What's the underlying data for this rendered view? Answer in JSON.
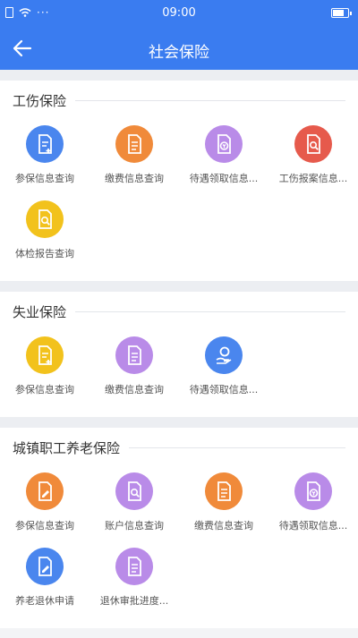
{
  "status": {
    "time": "09:00",
    "signal_dots": "···"
  },
  "header": {
    "title": "社会保险"
  },
  "colors": {
    "primary": "#3a7cf0",
    "blue": "#4a86ee",
    "orange": "#f08a3a",
    "purple": "#b98be8",
    "red": "#e65a4c",
    "yellow": "#f2c21c"
  },
  "sections": [
    {
      "title": "工伤保险",
      "items": [
        {
          "label": "参保信息查询",
          "color": "#4a86ee",
          "icon": "doc-plus-icon"
        },
        {
          "label": "缴费信息查询",
          "color": "#f08a3a",
          "icon": "doc-list-icon"
        },
        {
          "label": "待遇领取信息...",
          "color": "#b98be8",
          "icon": "doc-yuan-icon"
        },
        {
          "label": "工伤报案信息...",
          "color": "#e65a4c",
          "icon": "doc-search-icon"
        },
        {
          "label": "体检报告查询",
          "color": "#f2c21c",
          "icon": "doc-search-icon"
        }
      ]
    },
    {
      "title": "失业保险",
      "items": [
        {
          "label": "参保信息查询",
          "color": "#f2c21c",
          "icon": "doc-plus-icon"
        },
        {
          "label": "缴费信息查询",
          "color": "#b98be8",
          "icon": "doc-list-icon"
        },
        {
          "label": "待遇领取信息...",
          "color": "#4a86ee",
          "icon": "hand-coin-icon"
        }
      ]
    },
    {
      "title": "城镇职工养老保险",
      "items": [
        {
          "label": "参保信息查询",
          "color": "#f08a3a",
          "icon": "doc-edit-icon"
        },
        {
          "label": "账户信息查询",
          "color": "#b98be8",
          "icon": "doc-search-icon"
        },
        {
          "label": "缴费信息查询",
          "color": "#f08a3a",
          "icon": "doc-list-icon"
        },
        {
          "label": "待遇领取信息...",
          "color": "#b98be8",
          "icon": "doc-yuan-icon"
        },
        {
          "label": "养老退休申请",
          "color": "#4a86ee",
          "icon": "doc-edit-icon"
        },
        {
          "label": "退休审批进度...",
          "color": "#b98be8",
          "icon": "doc-list-icon"
        }
      ]
    }
  ]
}
